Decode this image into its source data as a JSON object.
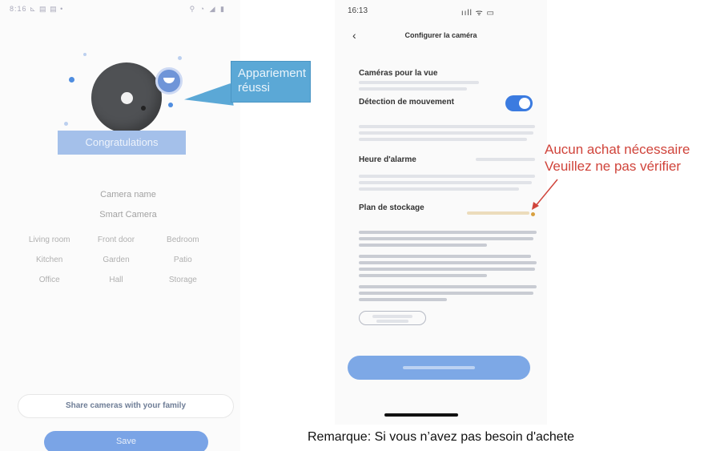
{
  "left_phone": {
    "status_left": "8:16 ⊾ ▤ ▤ •",
    "status_right": "⚲ ◔ ◢ ▮",
    "congrats": "Congratulations",
    "camera_name_label": "Camera name",
    "camera_name_value": "Smart Camera",
    "rooms": [
      "Living room",
      "Front door",
      "Bedroom",
      "Kitchen",
      "Garden",
      "Patio",
      "Office",
      "Hall",
      "Storage"
    ],
    "share_label": "Share cameras with your family",
    "save_label": "Save"
  },
  "callout": {
    "text": "Appariement réussi",
    "color": "#5ba8d6"
  },
  "right_phone": {
    "status_time": "16:13",
    "status_icons": "ııll ᯤ ▭",
    "back_icon": "chevron-left-icon",
    "title": "Configurer la caméra",
    "cameras_section_title": "Caméras pour la vue",
    "motion_title": "Détection de mouvement",
    "motion_enabled": true,
    "alarm_title": "Heure d'alarme",
    "storage_title": "Plan de stockage",
    "accent": "#3b7be0"
  },
  "annotation": {
    "text": "Aucun achat nécessaire Veuillez ne pas vérifier",
    "color": "#d0443b"
  },
  "remark": {
    "line1": "Remarque: Si vous n’avez pas besoin d'achete"
  }
}
